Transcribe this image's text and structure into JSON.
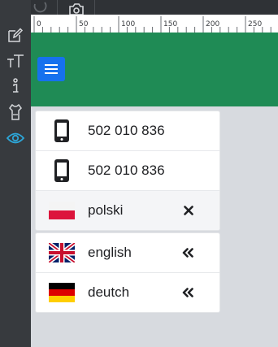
{
  "ruler": {
    "labels": [
      "0",
      "50",
      "100",
      "150",
      "200",
      "250"
    ]
  },
  "left_toolbar": {
    "tools": [
      {
        "icon": "edit-icon"
      },
      {
        "icon": "text-size-icon"
      },
      {
        "icon": "info-icon"
      },
      {
        "icon": "shirt-icon"
      },
      {
        "icon": "eye-icon",
        "active": true
      }
    ],
    "active_color": "#2da7d9"
  },
  "header": {
    "background": "#1f8b55",
    "menu_button_color": "#1671ee"
  },
  "contacts": [
    {
      "icon": "smartphone-icon",
      "text": "502 010 836"
    },
    {
      "icon": "smartphone-icon",
      "text": "502 010 836"
    }
  ],
  "languages": [
    {
      "flag": "poland-flag",
      "label": "polski",
      "action": "close-icon",
      "selected": true
    },
    {
      "flag": "uk-flag",
      "label": "english",
      "action": "double-chevron-left-icon"
    },
    {
      "flag": "germany-flag",
      "label": "deutch",
      "action": "double-chevron-left-icon"
    }
  ]
}
